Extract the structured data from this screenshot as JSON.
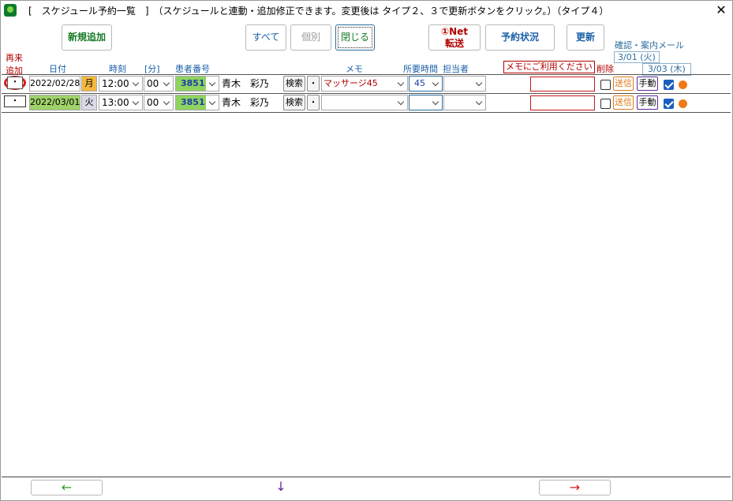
{
  "window": {
    "title": "[　スケジュール予約一覧　]　（スケジュールと連動・追加修正できます。変更後は タイプ２、３で更新ボタンをクリック。）（タイプ４）",
    "close_glyph": "✕"
  },
  "toolbar": {
    "new_label": "新規追加",
    "all_label": "すべて",
    "individual_label": "個別",
    "close_label": "閉じる",
    "net_line1": "①Net",
    "net_line2": "転送",
    "status_label": "予約状況",
    "refresh_label": "更新"
  },
  "headers": {
    "readd_1": "再来",
    "readd_2": "追加",
    "date": "日付",
    "time": "時刻",
    "minute": "[分]",
    "patient_no": "患者番号",
    "memo": "メモ",
    "duration": "所要時間",
    "staff": "担当者",
    "memo_hint": "メモにご利用ください",
    "delete": "削除",
    "confirm_mail": "確認・案内メール",
    "mail_date_1": "3/01 (火)",
    "mail_date_2": "3/03 (木)"
  },
  "rows": [
    {
      "readd": "・",
      "date": "2022/02/28",
      "weekday": "月",
      "time": "12:00",
      "minute": "00",
      "patient_no": "3851",
      "name": "青木　彩乃",
      "search": "検索",
      "bullet": "・",
      "memo": "マッサージ45",
      "duration": "45",
      "staff": "",
      "note": "",
      "send": "送信",
      "manual": "手動"
    },
    {
      "readd": "・",
      "date": "2022/03/01",
      "weekday": "火",
      "time": "13:00",
      "minute": "00",
      "patient_no": "3851",
      "name": "青木　彩乃",
      "search": "検索",
      "bullet": "・",
      "memo": "",
      "duration": "",
      "staff": "",
      "note": "",
      "send": "送信",
      "manual": "手動"
    }
  ],
  "footer": {
    "prev": "←",
    "down": "↓",
    "next": "→"
  },
  "colors": {
    "weekday_mon": "#f5b83d",
    "weekday_tue": "#d9d9e8",
    "date_row2": "#9fd26a",
    "patient_no_bg": "#8fd35f",
    "memo_text": "#b30000",
    "mail_dot": "#ef7a1a",
    "prev_arrow": "#2aa02a",
    "down_arrow": "#5a2a9a",
    "next_arrow": "#d01a1a"
  }
}
